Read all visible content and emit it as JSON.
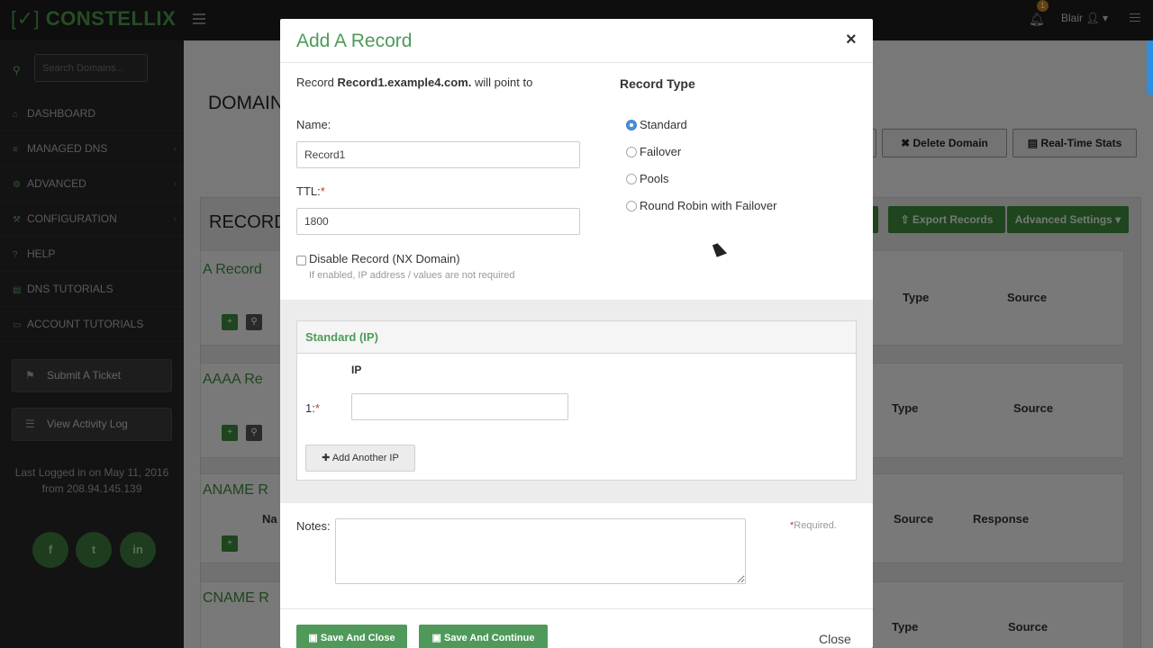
{
  "topbar": {
    "logo_bracket": "[✓]",
    "logo_text": "CONSTELLIX",
    "notification_count": "1",
    "user_name": "Blair"
  },
  "sidebar": {
    "search_placeholder": "Search Domains...",
    "items": [
      {
        "label": "DASHBOARD",
        "icon": "home-icon",
        "glyph": "⌂",
        "chevron": false
      },
      {
        "label": "MANAGED DNS",
        "icon": "list-icon",
        "glyph": "≡",
        "chevron": true
      },
      {
        "label": "ADVANCED",
        "icon": "cogs-icon",
        "glyph": "⚙",
        "chevron": true
      },
      {
        "label": "CONFIGURATION",
        "icon": "wrench-icon",
        "glyph": "⚒",
        "chevron": true
      },
      {
        "label": "HELP",
        "icon": "question-icon",
        "glyph": "?",
        "chevron": false
      },
      {
        "label": "DNS TUTORIALS",
        "icon": "book-icon",
        "glyph": "▤",
        "chevron": false
      },
      {
        "label": "ACCOUNT TUTORIALS",
        "icon": "laptop-icon",
        "glyph": "▭",
        "chevron": false
      }
    ],
    "submit_ticket": "Submit A Ticket",
    "view_activity": "View Activity Log",
    "last_login_line1": "Last Logged in on May 11, 2016",
    "last_login_line2": "from 208.94.145.139",
    "social": [
      "f",
      "t",
      "in"
    ]
  },
  "background": {
    "domain_title": "DOMAIN",
    "delete_domain": "Delete Domain",
    "realtime_stats": "Real-Time Stats",
    "records_title": "RECORD",
    "export_records": "Export Records",
    "advanced_settings": "Advanced Settings ▾",
    "sections": [
      {
        "title": "A Record",
        "col1": "Type",
        "col2": "Source"
      },
      {
        "title": "AAAA Re",
        "col1": "Type",
        "col2": "Source"
      },
      {
        "title": "ANAME R",
        "col0": "Na",
        "col1": "Source",
        "col2": "Response"
      },
      {
        "title": "CNAME R",
        "col1": "Type",
        "col2": "Source"
      }
    ]
  },
  "modal": {
    "title": "Add A Record",
    "close_symbol": "×",
    "point_prefix": "Record ",
    "point_record": "Record1.example4.com.",
    "point_suffix": " will point to",
    "name_label": "Name:",
    "name_value": "Record1",
    "ttl_label": "TTL:",
    "ttl_value": "1800",
    "required_star": "*",
    "disable_label": "Disable Record (NX Domain)",
    "disable_help": "If enabled, IP address / values are not required",
    "record_type_title": "Record Type",
    "record_types": [
      "Standard",
      "Failover",
      "Pools",
      "Round Robin with Failover"
    ],
    "selected_record_type": "Standard",
    "standard_title": "Standard (IP)",
    "ip_header": "IP",
    "ip_row_label": "1:",
    "ip_value": "",
    "add_ip": "Add Another IP",
    "notes_label": "Notes:",
    "notes_value": "",
    "required_note": "Required.",
    "save_close": "Save And Close",
    "save_continue": "Save And Continue",
    "close_link": "Close"
  },
  "colors": {
    "brand_green": "#4f9a5a",
    "selected_radio": "#4a90d9",
    "required_red": "#c0392b"
  }
}
